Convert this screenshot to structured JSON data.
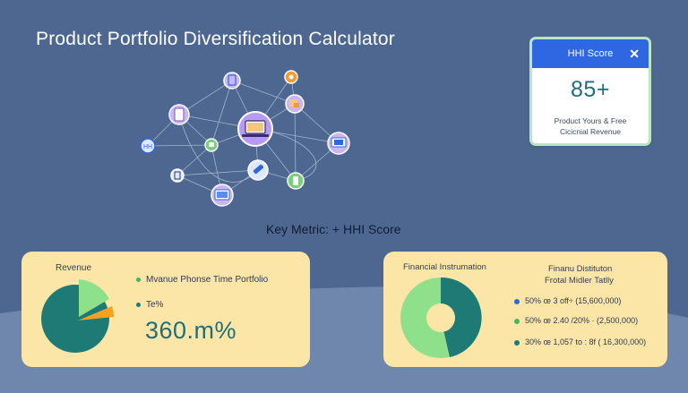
{
  "title": "Product Portfolio Diversification Calculator",
  "network": {
    "nodes": [
      {
        "name": "tablet-icon",
        "color": "#c9b8ef"
      },
      {
        "name": "phone-icon",
        "color": "#c9b8ef"
      },
      {
        "name": "laptop-icon",
        "color": "#c9b8ef"
      },
      {
        "name": "gear-icon",
        "color": "#f59a2b"
      },
      {
        "name": "box-icon",
        "color": "#c9b8ef"
      },
      {
        "name": "hhi-icon",
        "color": "#dfe8ff"
      },
      {
        "name": "cart-icon",
        "color": "#7ad07a"
      },
      {
        "name": "monitor-icon",
        "color": "#c9b8ef"
      },
      {
        "name": "device-icon",
        "color": "#dfe8ff"
      },
      {
        "name": "usb-icon",
        "color": "#dfe8ff"
      },
      {
        "name": "battery-icon",
        "color": "#7ad07a"
      },
      {
        "name": "screen-icon",
        "color": "#c9b8ef"
      }
    ]
  },
  "hhi_card": {
    "header": "HHI Score",
    "close": "✕",
    "value": "85+",
    "caption_line1": "Product Yours & Free",
    "caption_line2": "Cicicnial Revenue"
  },
  "key_metric": "Key Metric: + HHI Score",
  "left_panel": {
    "label": "Revenue",
    "legend_1": "Mvanue Phonse Time Portfolio",
    "legend_2": "Te%",
    "big_value": "360.m%",
    "colors": {
      "main": "#1d7a74",
      "slice_green": "#8fe08a",
      "slice_orange": "#f5a020"
    }
  },
  "right_panel": {
    "label": "Financial Instrumation",
    "heading_1": "Finanu Distituton",
    "heading_2": "Frotal Midler Tatlly",
    "rows": [
      {
        "text": "50% œ 3 off÷ (15,600,000)",
        "color": "#2f67e3"
      },
      {
        "text": "50% œ 2.40 /20% · (2,500,000)",
        "color": "#43b85a"
      },
      {
        "text": "30% œ 1,057 to : 8f ( 16,300,000)",
        "color": "#1d7a74"
      }
    ],
    "colors": {
      "dark": "#1d7a74",
      "light": "#8fe08a",
      "center": "#fbe6a8"
    }
  }
}
